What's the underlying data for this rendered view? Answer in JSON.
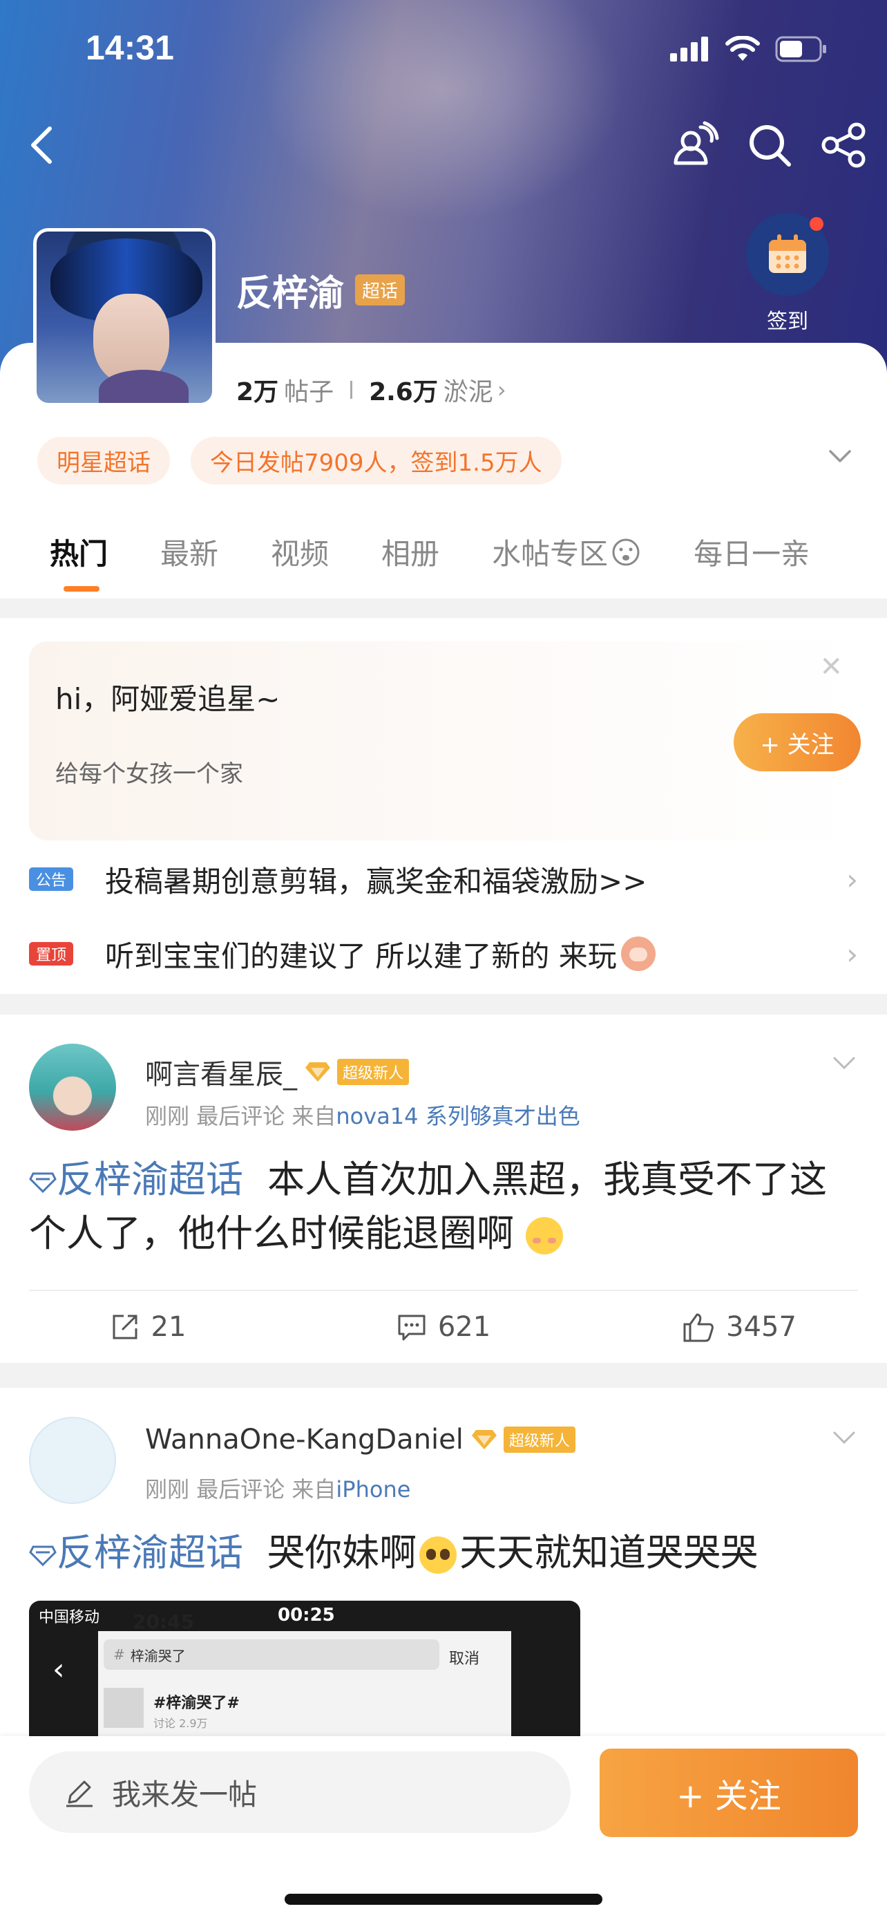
{
  "status_bar": {
    "time": "14:31"
  },
  "topic": {
    "name": "反梓渝",
    "tag": "超话",
    "checkin_label": "签到",
    "posts_count": "2万",
    "posts_label": "帖子",
    "mud_count": "2.6万",
    "mud_label": "淤泥",
    "pills": [
      "明星超话",
      "今日发帖7909人，签到1.5万人"
    ]
  },
  "tabs": [
    {
      "label": "热门",
      "active": true
    },
    {
      "label": "最新"
    },
    {
      "label": "视频"
    },
    {
      "label": "相册"
    },
    {
      "label": "水帖专区"
    },
    {
      "label": "每日一亲"
    }
  ],
  "banner": {
    "greeting": "hi，阿娅爱追星~",
    "subtitle": "给每个女孩一个家",
    "follow_label": "+ 关注"
  },
  "notices": [
    {
      "tag": "公告",
      "text": "投稿暑期创意剪辑，赢奖金和福袋激励>>",
      "color": "#4a90e2"
    },
    {
      "tag": "置顶",
      "text": "听到宝宝们的建议了 所以建了新的 来玩",
      "color": "#e8443a"
    }
  ],
  "posts": [
    {
      "user": "啊言看星辰_",
      "badge": "超级新人",
      "time": "刚刚",
      "meta": "最后评论",
      "source_prefix": "来自",
      "source": "nova14 系列够真才出色",
      "topic_link": "反梓渝超话",
      "text": "本人首次加入黑超，我真受不了这个人了，他什么时候能退圈啊",
      "reposts": "21",
      "comments": "621",
      "likes": "3457"
    },
    {
      "user": "WannaOne-KangDaniel",
      "badge": "超级新人",
      "time": "刚刚",
      "meta": "最后评论",
      "source_prefix": "来自",
      "source": "iPhone",
      "topic_link": "反梓渝超话",
      "text": "哭你妹啊",
      "text_2": "天天就知道哭哭哭",
      "image": {
        "carrier": "中国移动",
        "time_a": "20:45",
        "time_b": "00:25",
        "search_text": "梓渝哭了",
        "cancel": "取消",
        "result": "#梓渝哭了#",
        "result_sub": "讨论 2.9万"
      }
    }
  ],
  "bottom_bar": {
    "compose_placeholder": "我来发一帖",
    "follow_label": "+ 关注"
  },
  "colors": {
    "accent_orange": "#f28630",
    "topic_blue": "#4a79b6",
    "badge_gold": "#f5b437"
  }
}
